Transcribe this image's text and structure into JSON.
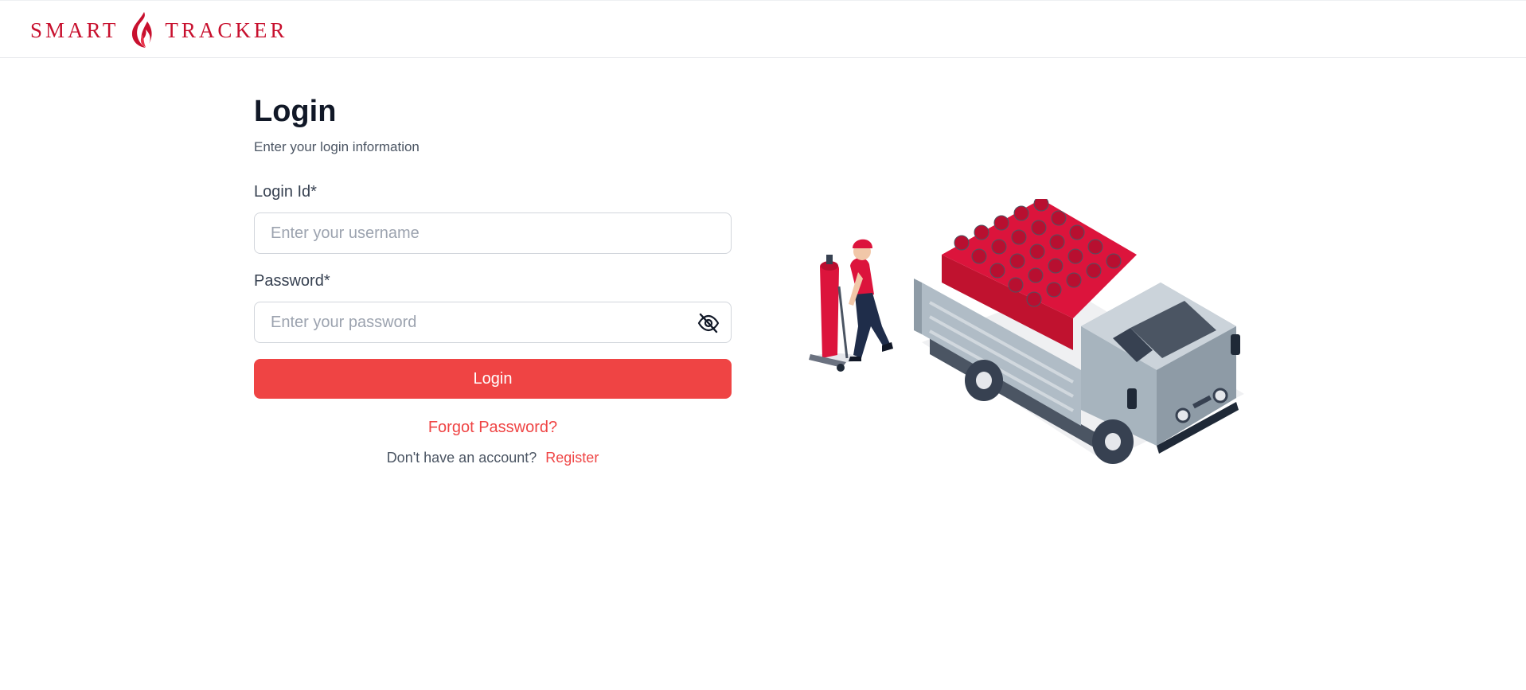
{
  "brand": {
    "left_word": "SMART",
    "right_word": "TRACKER",
    "color": "#c8102e"
  },
  "login": {
    "title": "Login",
    "subtitle": "Enter your login information",
    "login_id_label": "Login Id*",
    "username_placeholder": "Enter your username",
    "username_value": "",
    "password_label": "Password*",
    "password_placeholder": "Enter your password",
    "password_value": "",
    "password_toggle_icon": "eye-off-icon",
    "submit_label": "Login",
    "forgot_label": "Forgot Password?",
    "no_account_text": "Don't have an account?",
    "register_label": "Register"
  },
  "colors": {
    "accent": "#ef4444",
    "text_primary": "#111827",
    "text_secondary": "#4b5563",
    "border": "#d1d5db"
  },
  "illustration": {
    "icon": "delivery-truck-with-gas-cylinders-illustration"
  }
}
